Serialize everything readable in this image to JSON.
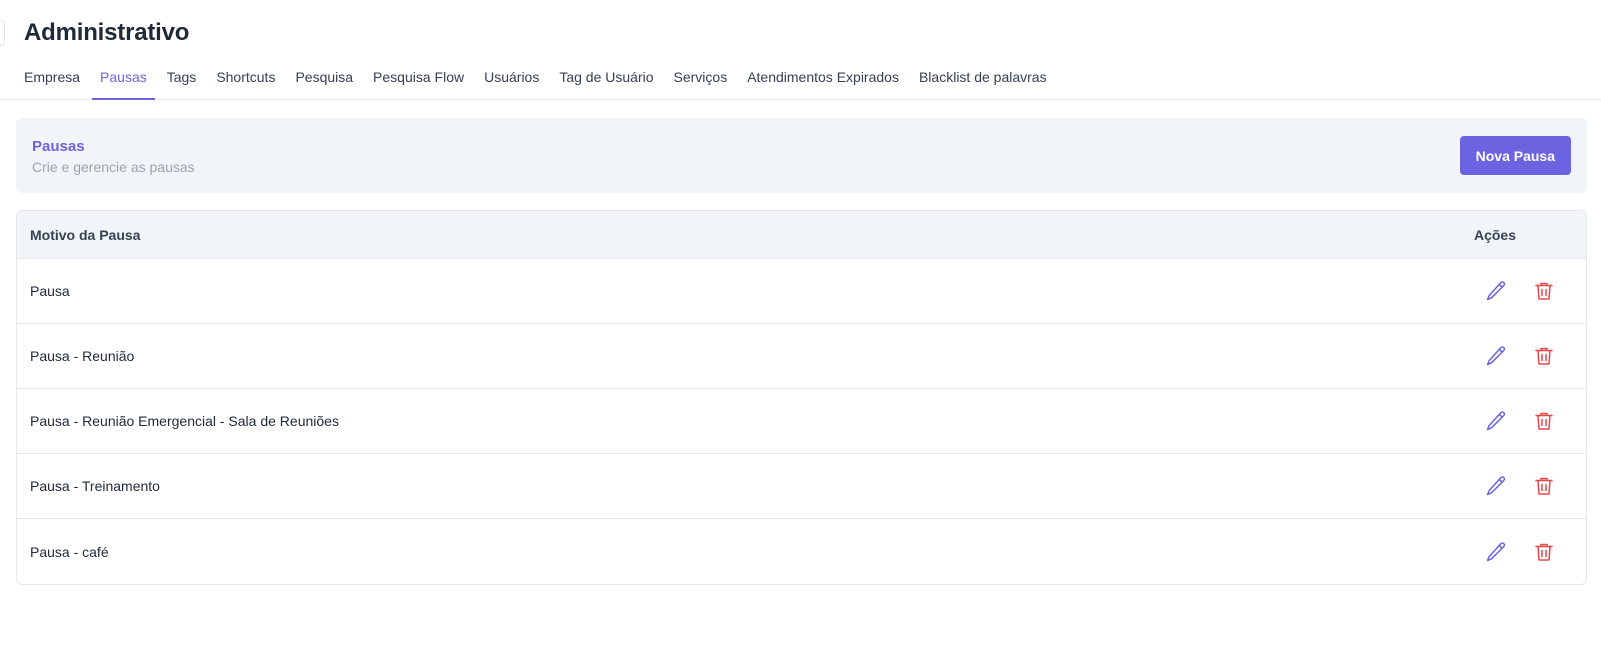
{
  "header": {
    "title": "Administrativo"
  },
  "tabs": [
    {
      "label": "Empresa",
      "active": false
    },
    {
      "label": "Pausas",
      "active": true
    },
    {
      "label": "Tags",
      "active": false
    },
    {
      "label": "Shortcuts",
      "active": false
    },
    {
      "label": "Pesquisa",
      "active": false
    },
    {
      "label": "Pesquisa Flow",
      "active": false
    },
    {
      "label": "Usuários",
      "active": false
    },
    {
      "label": "Tag de Usuário",
      "active": false
    },
    {
      "label": "Serviços",
      "active": false
    },
    {
      "label": "Atendimentos Expirados",
      "active": false
    },
    {
      "label": "Blacklist de palavras",
      "active": false
    }
  ],
  "banner": {
    "title": "Pausas",
    "subtitle": "Crie e gerencie as pausas",
    "button_label": "Nova Pausa"
  },
  "table": {
    "columns": {
      "reason": "Motivo da Pausa",
      "actions": "Ações"
    },
    "rows": [
      {
        "reason": "Pausa"
      },
      {
        "reason": "Pausa - Reunião"
      },
      {
        "reason": "Pausa - Reunião Emergencial - Sala de Reuniões"
      },
      {
        "reason": "Pausa - Treinamento"
      },
      {
        "reason": "Pausa - café"
      }
    ]
  },
  "icons": {
    "edit": "pencil-icon",
    "delete": "trash-icon"
  },
  "colors": {
    "accent": "#6b63e0",
    "danger": "#e5484d",
    "banner_bg": "#f1f4f8",
    "muted_text": "#9ca3af"
  }
}
